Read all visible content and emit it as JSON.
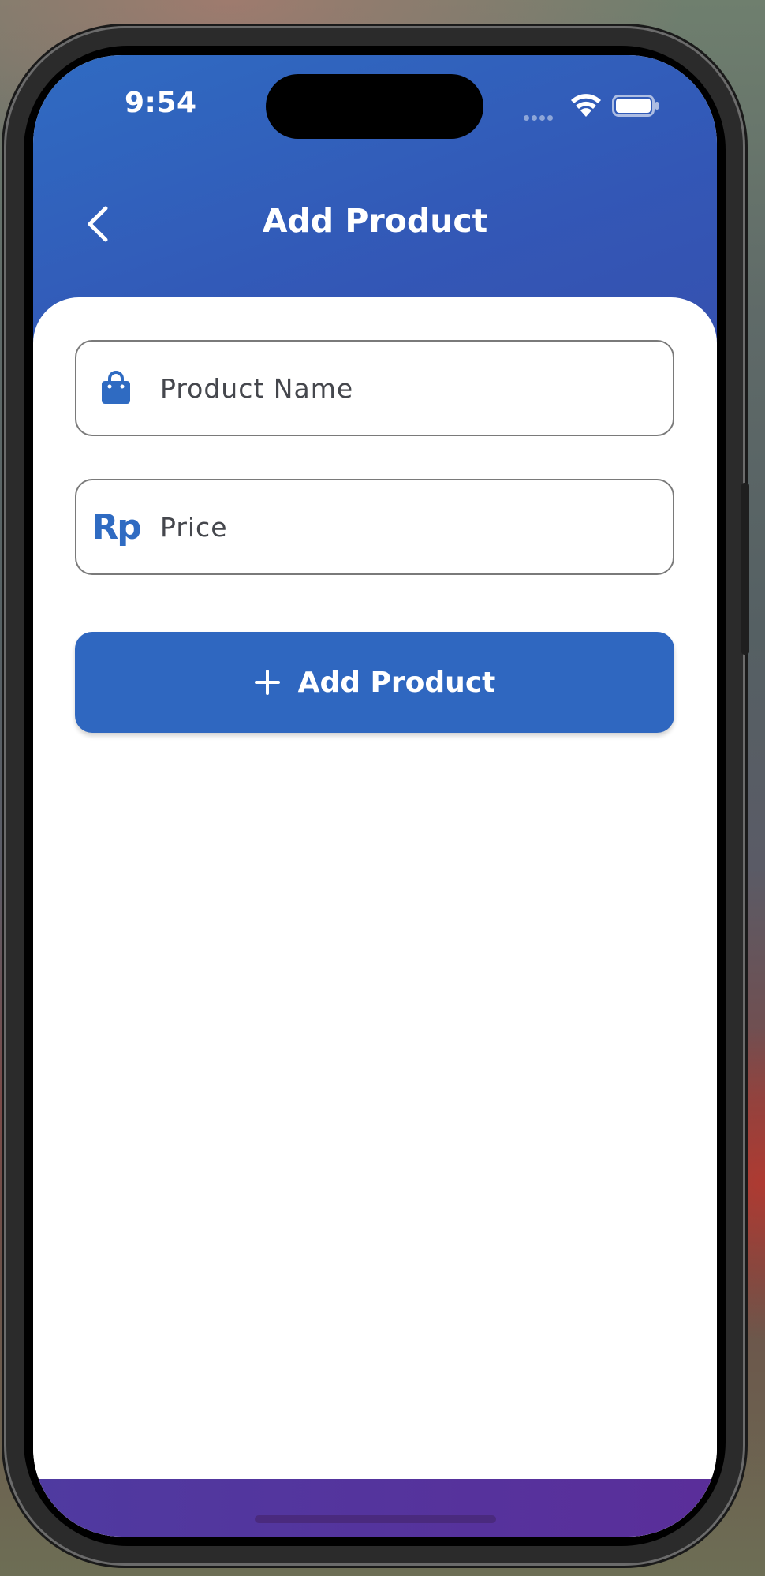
{
  "status_bar": {
    "time": "9:54",
    "icons": [
      "signal-dots-icon",
      "wifi-icon",
      "battery-icon"
    ]
  },
  "header": {
    "back_icon": "chevron-left-icon",
    "title": "Add Product"
  },
  "form": {
    "product_name": {
      "icon": "shopping-bag-icon",
      "placeholder": "Product Name",
      "value": ""
    },
    "price": {
      "icon": "rupiah-icon",
      "icon_text": "Rp",
      "placeholder": "Price",
      "value": ""
    }
  },
  "actions": {
    "add_button_icon": "plus-icon",
    "add_button_label": "Add Product"
  },
  "colors": {
    "header_gradient_start": "#2f6bc2",
    "header_gradient_end": "#3650ae",
    "primary": "#2f67c0",
    "field_border": "#7a7a7a",
    "bottom_bar": "#5a2e9a"
  }
}
